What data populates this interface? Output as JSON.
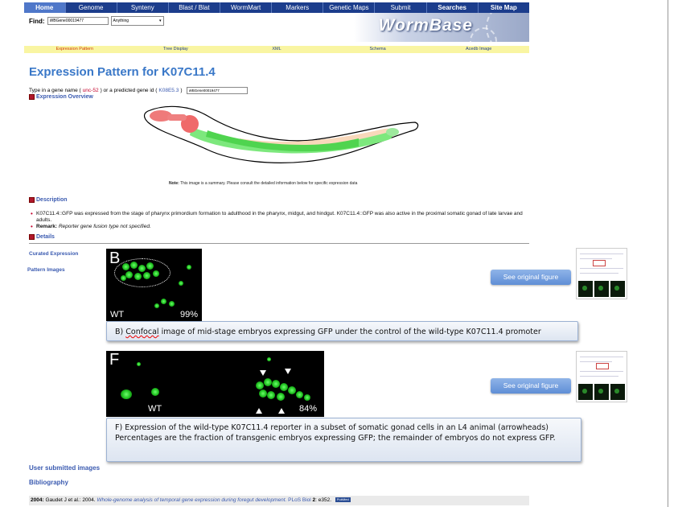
{
  "nav": {
    "items": [
      "Home",
      "Genome",
      "Synteny",
      "Blast / Blat",
      "WormMart",
      "Markers",
      "Genetic Maps",
      "Submit",
      "Searches",
      "Site Map"
    ]
  },
  "find": {
    "label": "Find:",
    "input_value": "WBGene00019477",
    "select_value": "Anything"
  },
  "banner": {
    "logo": "WormBase"
  },
  "subnav": {
    "items": [
      "Expression Pattern",
      "Tree Display",
      "XML",
      "Schema",
      "Acedb Image"
    ]
  },
  "page_title": "Expression Pattern for K07C11.4",
  "type_row": {
    "prefix": "Type in a gene name (",
    "gene_name": "unc-52",
    "middle": ") or a predicted gene id (",
    "gene_id": "K08E5.3",
    "suffix": ")",
    "input_value": "WBGene00019477"
  },
  "sections": {
    "overview": "Expression Overview",
    "description": "Description",
    "details": "Details"
  },
  "note": {
    "label": "Note:",
    "text": "This image is a summary. Please consult the detailed information below for specific expression data"
  },
  "description": {
    "text": "K07C11.4::GFP was expressed from the stage of pharynx primordium formation to adulthood in the pharynx, midgut, and hindgut. K07C11.4::GFP was also active in the proximal somatic gonad of late larvae and adults.",
    "remark_label": "Remark:",
    "remark_text": "Reporter gene fusion type not specified."
  },
  "side_links": {
    "curated": "Curated Expression",
    "pattern_images": "Pattern Images",
    "user_images": "User submitted images",
    "bibliography": "Bibliography"
  },
  "figures": {
    "b": {
      "letter": "B",
      "wt": "WT",
      "pct": "99%",
      "caption_pre": "B) ",
      "caption_spell": "Confocal",
      "caption_post": " image of mid-stage embryos expressing GFP under the control of the wild-type K07C11.4 promoter"
    },
    "f": {
      "letter": "F",
      "wt": "WT",
      "pct": "84%",
      "caption": "F) Expression of the wild-type K07C11.4 reporter in a subset of somatic gonad cells in an L4 animal (arrowheads)  Percentages are the fraction of transgenic embryos expressing GFP; the remainder of embryos do not express GFP."
    },
    "see_original": "See original figure"
  },
  "bibliography": {
    "year": "2004:",
    "authors": "Gaudet J et al.: 2004.",
    "title": "Whole-genome analysis of temporal gene expression during foregut development.",
    "journal": "PLoS Biol",
    "volume": "2",
    "pages": ": e352.",
    "pubmed": "PubMed"
  },
  "colors": {
    "nav_bg": "#1c3d8c",
    "title": "#3a78c8",
    "link": "#3a5ab0",
    "subnav_bg": "#f9f5a2",
    "gfp_green": "#3fd43f"
  }
}
